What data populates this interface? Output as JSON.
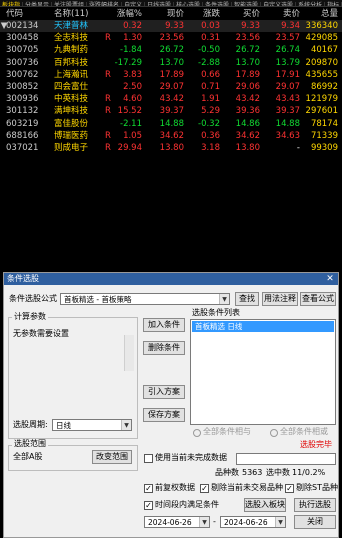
{
  "tabs": [
    "板块指",
    "分类显示",
    "关注股票组",
    "涨跌幅排名",
    "自定义",
    "日线选股",
    "核心选股",
    "条件选股",
    "智能选股",
    "自定义选股",
    "系统分析",
    "指标"
  ],
  "table": {
    "headers": {
      "flag": "",
      "code": "代码",
      "name": "名称(11)",
      "chg": "涨幅%",
      "price": "现价",
      "delta": "涨跌",
      "bid": "买价",
      "ask": "卖价",
      "vol": "总量"
    },
    "rows": [
      {
        "flag": "▼",
        "code": "002134",
        "name": "天津普林",
        "mark": "",
        "chg": "0.32",
        "price": "9.33",
        "delta": "0.03",
        "bid": "9.33",
        "ask": "9.34",
        "vol": "336340",
        "color": "red"
      },
      {
        "flag": "",
        "code": "300458",
        "name": "全志科技",
        "mark": "R",
        "chg": "1.30",
        "price": "23.56",
        "delta": "0.31",
        "bid": "23.56",
        "ask": "23.57",
        "vol": "429085",
        "color": "red"
      },
      {
        "flag": "",
        "code": "300705",
        "name": "九典制药",
        "mark": "",
        "chg": "-1.84",
        "price": "26.72",
        "delta": "-0.50",
        "bid": "26.72",
        "ask": "26.74",
        "vol": "40167",
        "color": "green"
      },
      {
        "flag": "",
        "code": "300736",
        "name": "百邦科技",
        "mark": "",
        "chg": "-17.29",
        "price": "13.70",
        "delta": "-2.88",
        "bid": "13.70",
        "ask": "13.79",
        "vol": "209870",
        "color": "green"
      },
      {
        "flag": "",
        "code": "300762",
        "name": "上海瀚讯",
        "mark": "R",
        "chg": "3.83",
        "price": "17.89",
        "delta": "0.66",
        "bid": "17.89",
        "ask": "17.91",
        "vol": "435655",
        "color": "red"
      },
      {
        "flag": "",
        "code": "300852",
        "name": "四会富仕",
        "mark": "",
        "chg": "2.50",
        "price": "29.07",
        "delta": "0.71",
        "bid": "29.06",
        "ask": "29.07",
        "vol": "86992",
        "color": "red"
      },
      {
        "flag": "",
        "code": "300936",
        "name": "中英科技",
        "mark": "R",
        "chg": "4.60",
        "price": "43.42",
        "delta": "1.91",
        "bid": "43.42",
        "ask": "43.43",
        "vol": "121979",
        "color": "red"
      },
      {
        "flag": "",
        "code": "301132",
        "name": "满坤科技",
        "mark": "R",
        "chg": "15.52",
        "price": "39.37",
        "delta": "5.29",
        "bid": "39.36",
        "ask": "39.37",
        "vol": "297601",
        "color": "red"
      },
      {
        "flag": "",
        "code": "603219",
        "name": "富佳股份",
        "mark": "",
        "chg": "-2.11",
        "price": "14.88",
        "delta": "-0.32",
        "bid": "14.86",
        "ask": "14.88",
        "vol": "78174",
        "color": "green"
      },
      {
        "flag": "",
        "code": "688166",
        "name": "博瑞医药",
        "mark": "R",
        "chg": "1.05",
        "price": "34.62",
        "delta": "0.36",
        "bid": "34.62",
        "ask": "34.63",
        "vol": "71339",
        "color": "red"
      },
      {
        "flag": "",
        "code": "037021",
        "name": "则成电子",
        "mark": "R",
        "chg": "29.94",
        "price": "13.80",
        "delta": "3.18",
        "bid": "13.80",
        "ask": "-",
        "vol": "99309",
        "color": "red"
      }
    ]
  },
  "dialog": {
    "title": "条件选股",
    "formula_label": "条件选股公式",
    "formula_value": "首板精选 - 首板策略",
    "find_button": "查找",
    "usage_button": "用法注释",
    "view_formula_button": "查看公式",
    "params_group": "计算参数",
    "params_text": "无参数需要设置",
    "add_condition": "加入条件",
    "delete_condition": "删除条件",
    "load_plan": "引入方案",
    "save_plan": "保存方案",
    "cond_list_group": "选股条件列表",
    "cond_list_items": [
      "首板精选 日线"
    ],
    "radio_and": "全部条件相与",
    "radio_or": "全部条件相或",
    "period_label": "选股周期:",
    "period_value": "日线",
    "range_group": "选股范围",
    "range_value": "全部A股",
    "change_range": "改变范围",
    "use_unfinished": "使用当前未完成数据",
    "use_unfinished_checked": false,
    "stock_count_label": "品种数",
    "stock_count": "5363",
    "selected_label": "选中数",
    "selected_value": "11/0.2%",
    "select_mode": "选股入板块",
    "exact_link": "选股完毕",
    "pre_rights": "前复权数据",
    "pre_rights_checked": true,
    "remove_suspended": "剔除当前未交易品种",
    "remove_suspended_checked": true,
    "remove_st": "剔除ST品种",
    "remove_st_checked": true,
    "time_range": "时间段内满足条件",
    "time_range_checked": true,
    "to_block": "选股入板块",
    "execute": "执行选股",
    "date_from": "2024-06-26",
    "date_to": "2024-06-26",
    "close": "关闭"
  }
}
